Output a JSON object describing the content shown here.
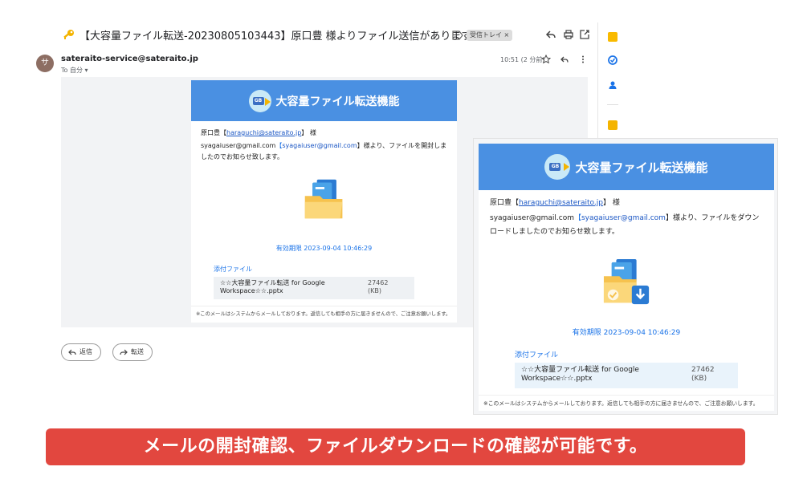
{
  "email": {
    "subject": "【大容量ファイル転送-20230805103443】原口豊 様よりファイル送信があります。",
    "inbox_label": "受信トレイ ×",
    "sender_avatar_letter": "サ",
    "sender_email": "sateraito-service@sateraito.jp",
    "to_line": "To 自分 ▾",
    "time": "10:51 (2 分前)",
    "reply_button": "返信",
    "forward_button": "転送"
  },
  "mail_open": {
    "banner_title": "大容量ファイル転送機能",
    "logo_badge": "GB",
    "recipient_name": "原口豊【",
    "recipient_link": "haraguchi@sateraito.jp",
    "recipient_suffix": "】 様",
    "user_plain": "syagaiuser@gmail.com",
    "user_bracket_open": "【",
    "user_link": "syagaiuser@gmail.com",
    "message": "】様より、ファイルを開封しましたのでお知らせ致します。",
    "expiry": "有効期限 2023-09-04 10:46:29",
    "attachment_label": "添付ファイル",
    "attachment_name": "☆☆大容量ファイル転送 for Google Workspace☆☆.pptx",
    "attachment_size": "27462\n(KB)",
    "footer": "※このメールはシステムからメールしております。返信しても相手の方に届きませんので、ご注意お願いします。"
  },
  "mail_download": {
    "banner_title": "大容量ファイル転送機能",
    "logo_badge": "GB",
    "recipient_name": "原口豊【",
    "recipient_link": "haraguchi@sateraito.jp",
    "recipient_suffix": "】 様",
    "user_plain": "syagaiuser@gmail.com",
    "user_bracket_open": "【",
    "user_link": "syagaiuser@gmail.com",
    "message": "】様より、ファイルをダウンロードしましたのでお知らせ致します。",
    "expiry": "有効期限 2023-09-04 10:46:29",
    "attachment_label": "添付ファイル",
    "attachment_name": "☆☆大容量ファイル転送 for Google Workspace☆☆.pptx",
    "attachment_size": "27462\n(KB)",
    "footer": "※このメールはシステムからメールしております。返信しても相手の方に届きませんので、ご注意お願いします。"
  },
  "caption": "メールの開封確認、ファイルダウンロードの確認が可能です。",
  "colors": {
    "banner": "#4a90e2",
    "caption_bg": "#e2473f",
    "link": "#1a56c4",
    "accent": "#1a73e8"
  },
  "icons": [
    "key-icon",
    "label-icon",
    "reply-all-icon",
    "print-icon",
    "open-new-icon",
    "star-icon",
    "reply-icon",
    "more-icon",
    "folder-icon",
    "download-icon",
    "keep-icon",
    "tasks-icon",
    "contacts-icon"
  ]
}
